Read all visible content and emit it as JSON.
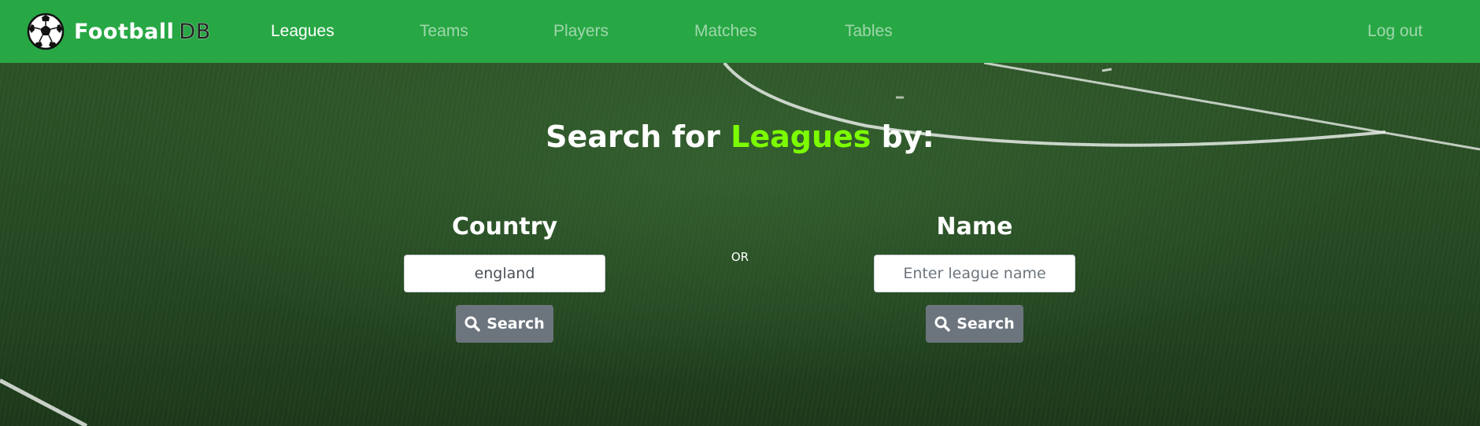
{
  "brand": {
    "name": "Football",
    "suffix": "DB",
    "icon": "soccer-ball-icon"
  },
  "nav": {
    "items": [
      {
        "label": "Leagues",
        "active": true
      },
      {
        "label": "Teams",
        "active": false
      },
      {
        "label": "Players",
        "active": false
      },
      {
        "label": "Matches",
        "active": false
      },
      {
        "label": "Tables",
        "active": false
      }
    ],
    "logout_label": "Log out"
  },
  "heading": {
    "prefix": "Search for",
    "accent": "Leagues",
    "suffix": "by:"
  },
  "country_search": {
    "title": "Country",
    "value": "england",
    "placeholder": "",
    "button_label": "Search",
    "button_icon": "search-icon"
  },
  "separator": "OR",
  "name_search": {
    "title": "Name",
    "value": "",
    "placeholder": "Enter league name",
    "button_label": "Search",
    "button_icon": "search-icon"
  },
  "colors": {
    "navbar": "#28a745",
    "accent": "#7cfc00",
    "button": "#6c757d"
  }
}
